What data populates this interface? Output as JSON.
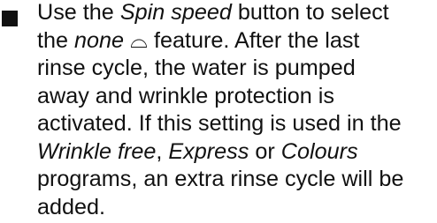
{
  "instruction": {
    "lines": [
      {
        "before": "Use the ",
        "em": "Spin speed",
        "after": " button to select"
      },
      {
        "before": "the ",
        "em": "none",
        "icon": "⌓",
        "after": " feature. After the last"
      },
      {
        "text": "rinse cycle, the water is pumped"
      },
      {
        "text": "away and wrinkle protection is"
      },
      {
        "text": "activated. If this setting is used in the"
      },
      {
        "em1": "Wrinkle free",
        "mid1": ", ",
        "em2": "Express",
        "mid2": " or ",
        "em3": "Colours"
      },
      {
        "text": "programs, an extra rinse cycle will be"
      },
      {
        "text": "added."
      }
    ],
    "icon_name": "no-spin-icon"
  }
}
